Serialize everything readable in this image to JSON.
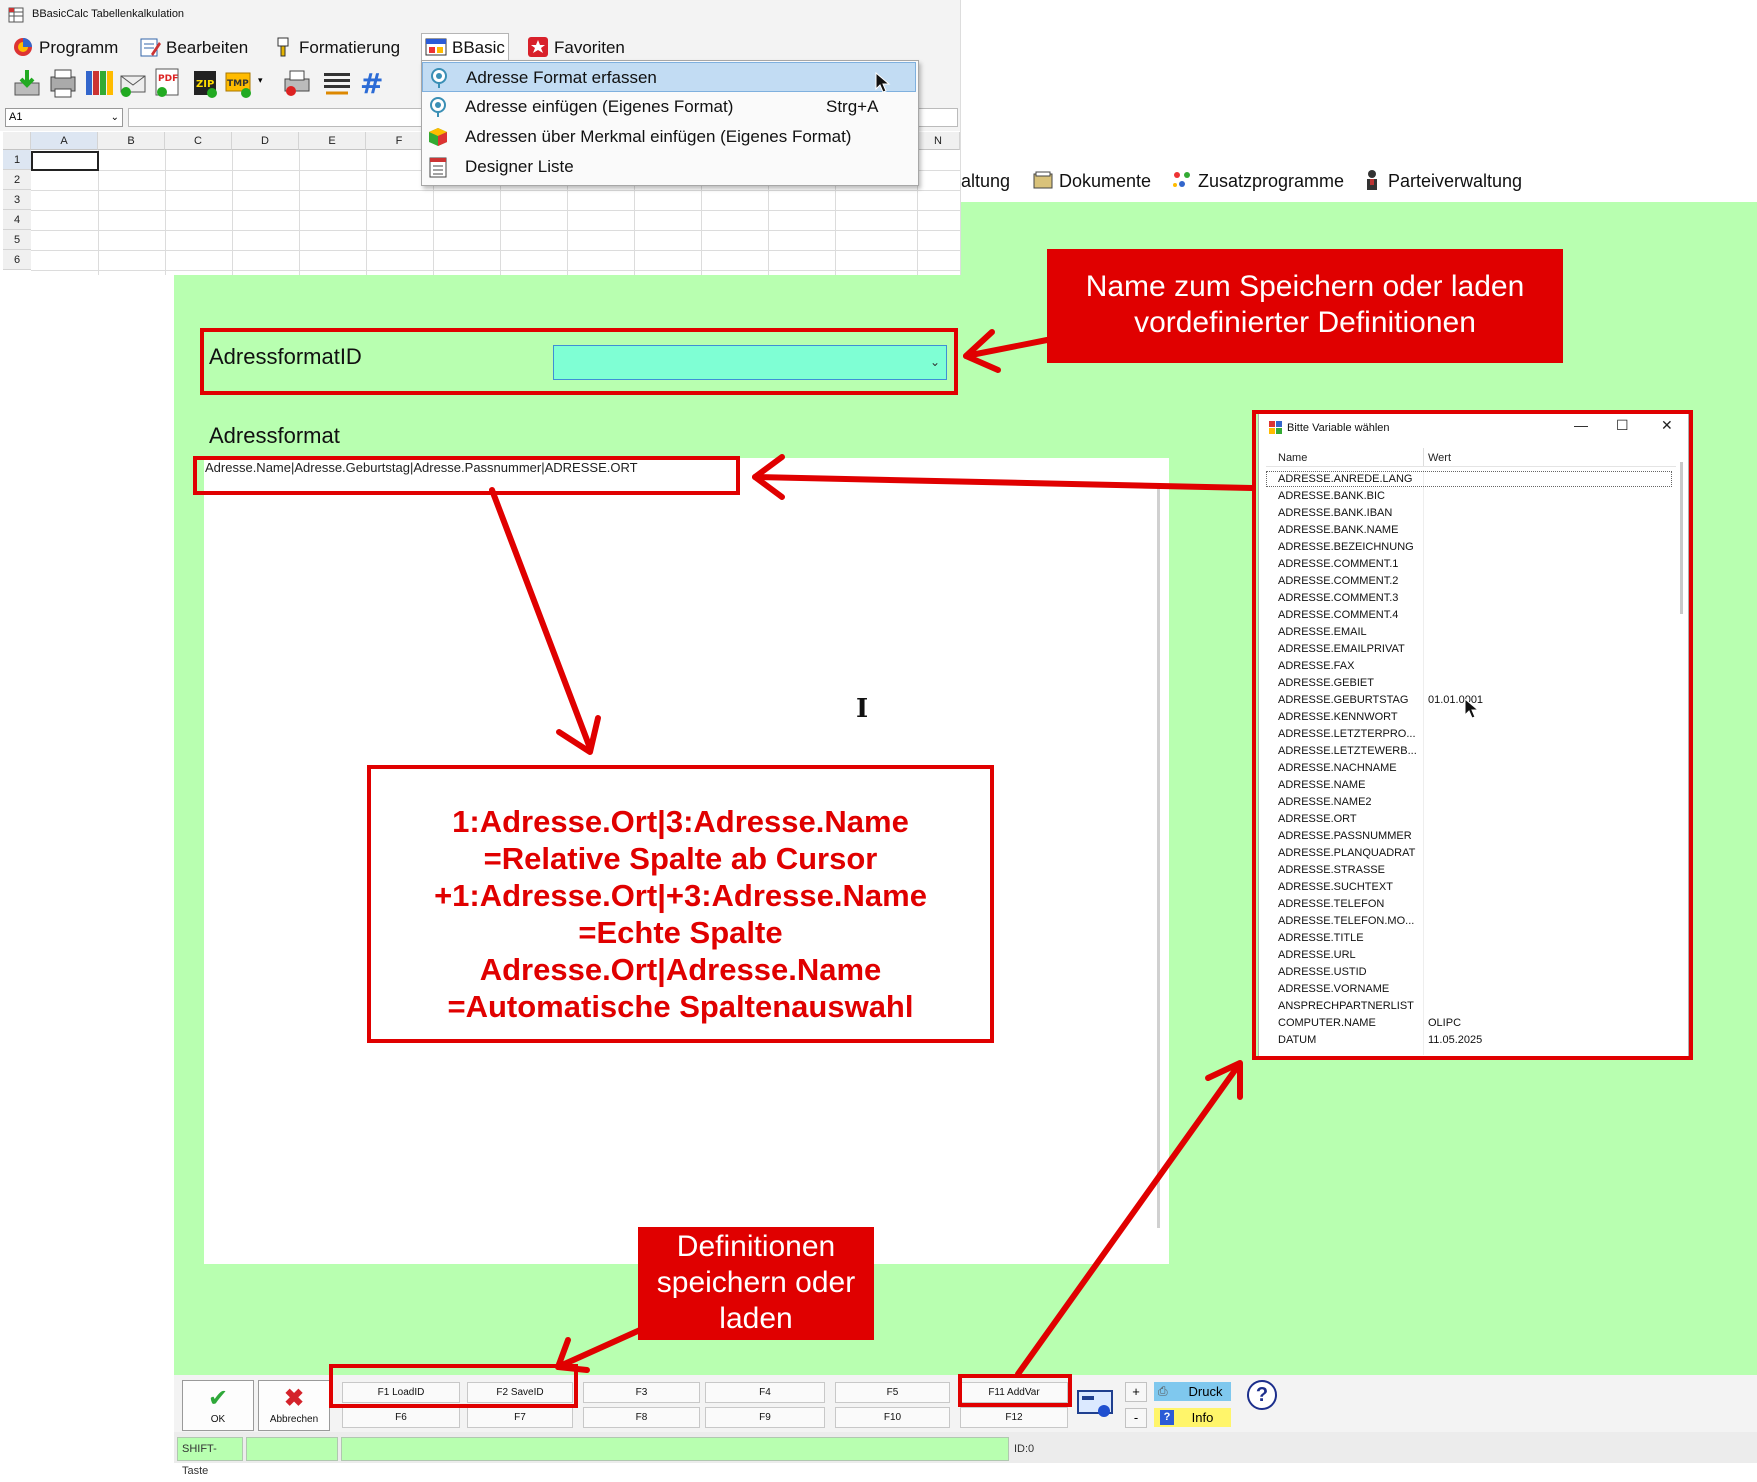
{
  "spreadsheet": {
    "window_title": "BBasicCalc Tabellenkalkulation",
    "menu": [
      "Programm",
      "Bearbeiten",
      "Formatierung",
      "BBasic",
      "Favoriten"
    ],
    "cell_reference": "A1",
    "columns": [
      "A",
      "B",
      "C",
      "D",
      "E",
      "F",
      "N"
    ],
    "rows": [
      "1",
      "2",
      "3",
      "4",
      "5",
      "6"
    ]
  },
  "bbasic_menu": {
    "items": [
      {
        "label": "Adresse Format erfassen",
        "shortcut": "",
        "highlighted": true
      },
      {
        "label": "Adresse einfügen (Eigenes Format)",
        "shortcut": "Strg+A",
        "highlighted": false
      },
      {
        "label": "Adressen über Merkmal einfügen (Eigenes Format)",
        "shortcut": "",
        "highlighted": false
      },
      {
        "label": "Designer Liste",
        "shortcut": "",
        "highlighted": false
      }
    ]
  },
  "main_window": {
    "menu": [
      "waltung",
      "Dokumente",
      "Zusatzprogramme",
      "Parteiverwaltung"
    ],
    "adressformat_id_label": "AdressformatID",
    "adressformat_id_value": "",
    "adressformat_label": "Adressformat",
    "adressformat_value": "Adresse.Name|Adresse.Geburtstag|Adresse.Passnummer|ADRESSE.ORT",
    "ok_label": "OK",
    "cancel_label": "Abbrechen",
    "fkeys_top": [
      "F1 LoadID",
      "F2 SaveID",
      "F3",
      "F4",
      "F5",
      "F11 AddVar"
    ],
    "fkeys_bottom": [
      "F6",
      "F7",
      "F8",
      "F9",
      "F10",
      "F12"
    ],
    "plus_label": "+",
    "minus_label": "-",
    "druck_label": "Druck",
    "info_label": "Info",
    "status": {
      "shift": "SHIFT-Taste",
      "id": "ID:0"
    }
  },
  "variable_window": {
    "title": "Bitte Variable wählen",
    "col_name": "Name",
    "col_value": "Wert",
    "rows": [
      {
        "name": "ADRESSE.ANREDE.LANG",
        "value": ""
      },
      {
        "name": "ADRESSE.BANK.BIC",
        "value": ""
      },
      {
        "name": "ADRESSE.BANK.IBAN",
        "value": ""
      },
      {
        "name": "ADRESSE.BANK.NAME",
        "value": ""
      },
      {
        "name": "ADRESSE.BEZEICHNUNG",
        "value": ""
      },
      {
        "name": "ADRESSE.COMMENT.1",
        "value": ""
      },
      {
        "name": "ADRESSE.COMMENT.2",
        "value": ""
      },
      {
        "name": "ADRESSE.COMMENT.3",
        "value": ""
      },
      {
        "name": "ADRESSE.COMMENT.4",
        "value": ""
      },
      {
        "name": "ADRESSE.EMAIL",
        "value": ""
      },
      {
        "name": "ADRESSE.EMAILPRIVAT",
        "value": ""
      },
      {
        "name": "ADRESSE.FAX",
        "value": ""
      },
      {
        "name": "ADRESSE.GEBIET",
        "value": ""
      },
      {
        "name": "ADRESSE.GEBURTSTAG",
        "value": "01.01.0001"
      },
      {
        "name": "ADRESSE.KENNWORT",
        "value": ""
      },
      {
        "name": "ADRESSE.LETZTERPRO...",
        "value": ""
      },
      {
        "name": "ADRESSE.LETZTEWERB...",
        "value": ""
      },
      {
        "name": "ADRESSE.NACHNAME",
        "value": ""
      },
      {
        "name": "ADRESSE.NAME",
        "value": ""
      },
      {
        "name": "ADRESSE.NAME2",
        "value": ""
      },
      {
        "name": "ADRESSE.ORT",
        "value": ""
      },
      {
        "name": "ADRESSE.PASSNUMMER",
        "value": ""
      },
      {
        "name": "ADRESSE.PLANQUADRAT",
        "value": ""
      },
      {
        "name": "ADRESSE.STRASSE",
        "value": ""
      },
      {
        "name": "ADRESSE.SUCHTEXT",
        "value": ""
      },
      {
        "name": "ADRESSE.TELEFON",
        "value": ""
      },
      {
        "name": "ADRESSE.TELEFON.MO...",
        "value": ""
      },
      {
        "name": "ADRESSE.TITLE",
        "value": ""
      },
      {
        "name": "ADRESSE.URL",
        "value": ""
      },
      {
        "name": "ADRESSE.USTID",
        "value": ""
      },
      {
        "name": "ADRESSE.VORNAME",
        "value": ""
      },
      {
        "name": "ANSPRECHPARTNERLIST",
        "value": ""
      },
      {
        "name": "COMPUTER.NAME",
        "value": "OLIPC"
      },
      {
        "name": "DATUM",
        "value": "11.05.2025"
      }
    ]
  },
  "annotations": {
    "name_callout": "Name zum Speichern oder laden vordefinierter Definitionen",
    "definitions_callout": "Definitionen speichern oder laden",
    "info_lines": [
      "1:Adresse.Ort|3:Adresse.Name",
      "=Relative Spalte ab Cursor",
      "+1:Adresse.Ort|+3:Adresse.Name",
      "=Echte Spalte",
      "Adresse.Ort|Adresse.Name",
      "=Automatische Spaltenauswahl"
    ]
  },
  "colors": {
    "green_background": "#b8ffb0",
    "annotation_red": "#e00000",
    "combo_fill": "#7fffd4",
    "menu_highlight": "#c2dcf3"
  }
}
